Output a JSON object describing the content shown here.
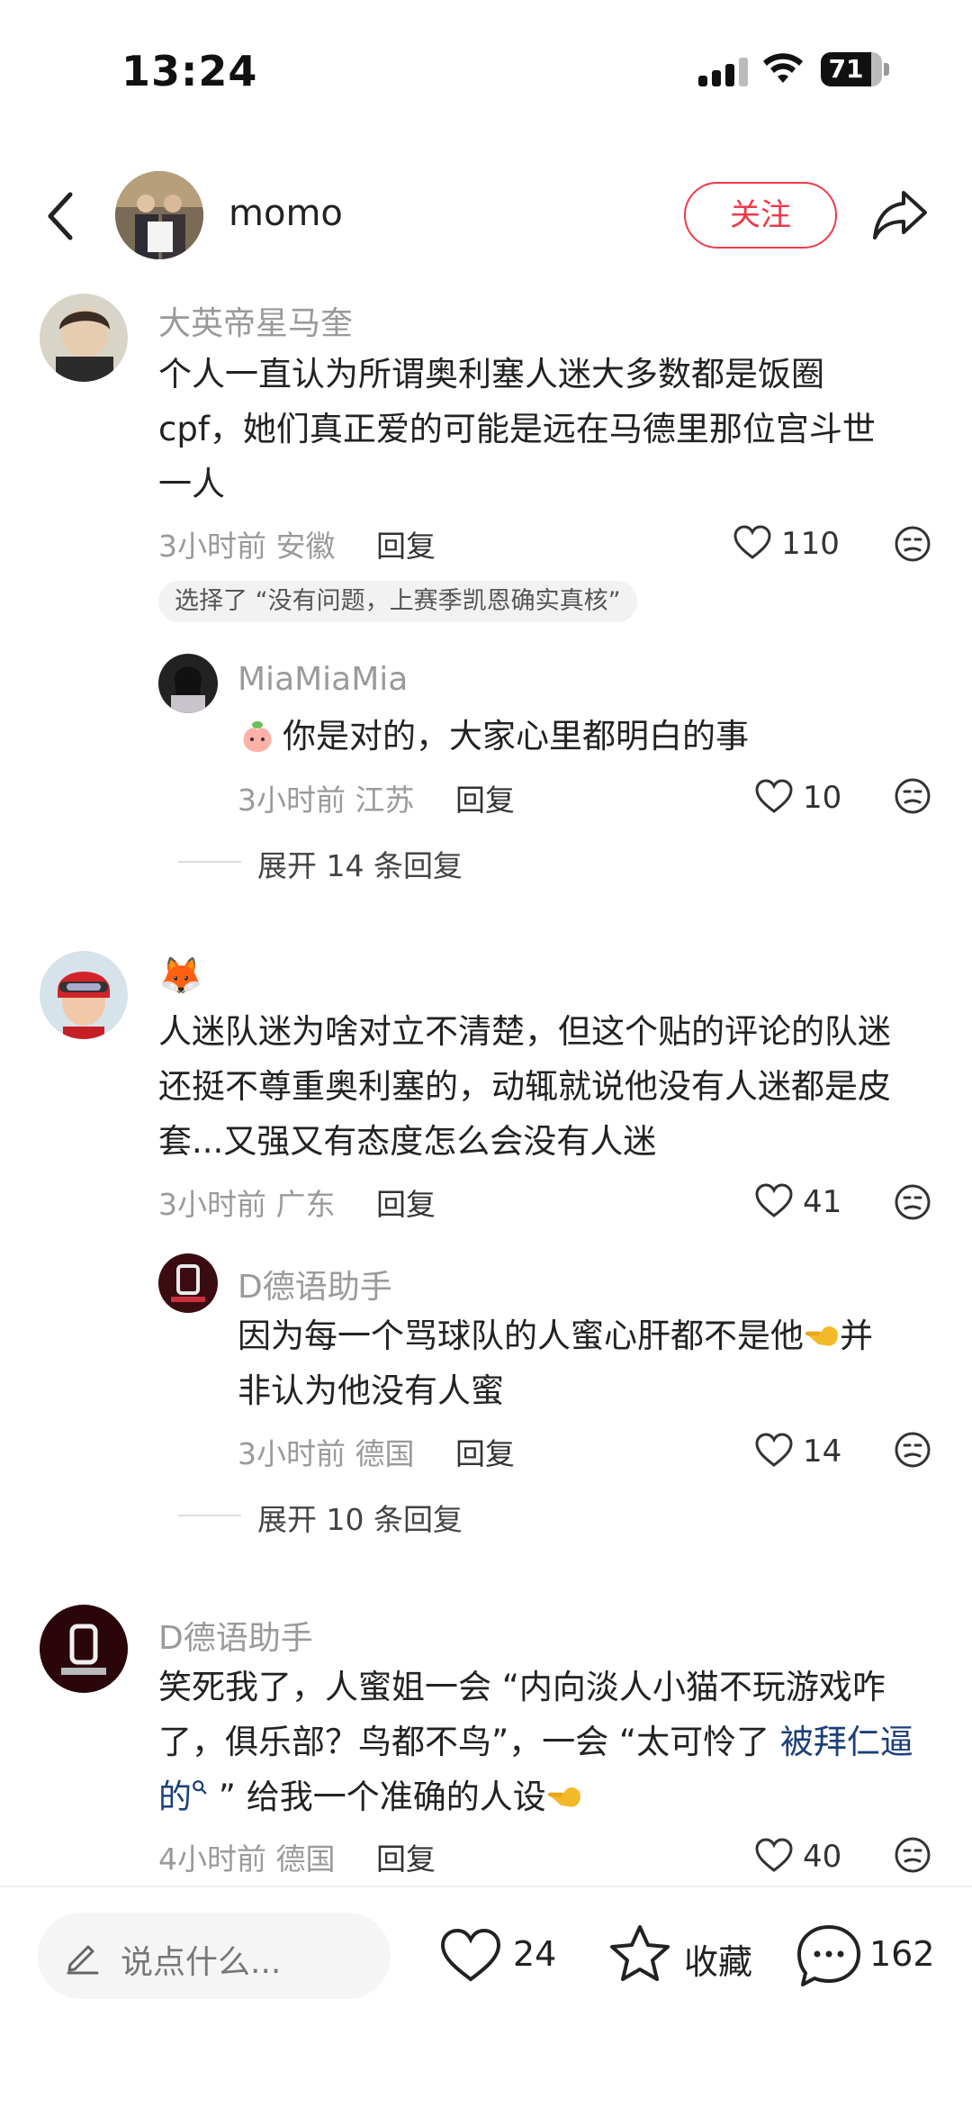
{
  "status_bar": {
    "time": "13:24",
    "battery": "71"
  },
  "header": {
    "username": "momo",
    "follow_label": "关注"
  },
  "comments": [
    {
      "name": "大英帝星马奎",
      "text_lines": [
        "个人一直认为所谓奥利塞人迷大多数都是饭圈",
        "cpf，她们真正爱的可能是远在马德里那位宫斗世",
        "一人"
      ],
      "time_location": "3小时前 安徽",
      "reply_label": "回复",
      "likes": "110",
      "tag": "选择了 “没有问题，上赛季凯恩确实真核”",
      "sub": {
        "name": "MiaMiaMia",
        "text": "你是对的，大家心里都明白的事",
        "time_location": "3小时前 江苏",
        "reply_label": "回复",
        "likes": "10"
      },
      "expand": "展开 14 条回复"
    },
    {
      "name": "🦊",
      "text_lines": [
        "人迷队迷为啥对立不清楚，但这个贴的评论的队迷",
        "还挺不尊重奥利塞的，动辄就说他没有人迷都是皮",
        "套...又强又有态度怎么会没有人迷"
      ],
      "time_location": "3小时前 广东",
      "reply_label": "回复",
      "likes": "41",
      "sub": {
        "name": "D德语助手",
        "text_lines": [
          "因为每一个骂球队的人蜜心肝都不是他",
          "并",
          "非认为他没有人蜜"
        ],
        "time_location": "3小时前 德国",
        "reply_label": "回复",
        "likes": "14"
      },
      "expand": "展开 10 条回复"
    },
    {
      "name": "D德语助手",
      "text_lines": [
        "笑死我了，人蜜姐一会 “内向淡人小猫不玩游戏咋",
        "了，俱乐部？鸟都不鸟”，一会 “太可怜了 ",
        "的",
        " ” 给我一个准确的人设"
      ],
      "link_text_a": "被拜仁逼",
      "time_location": "4小时前 德国",
      "reply_label": "回复",
      "likes": "40"
    }
  ],
  "bottom_bar": {
    "input_placeholder": "说点什么...",
    "likes": "24",
    "collect_label": "收藏",
    "comments": "162"
  },
  "colors": {
    "accent": "#ee3a4a",
    "link": "#1d3f7a"
  },
  "icons": [
    "back-icon",
    "share-icon",
    "heart-icon",
    "face-icon",
    "pencil-icon",
    "star-icon",
    "comment-icon"
  ]
}
